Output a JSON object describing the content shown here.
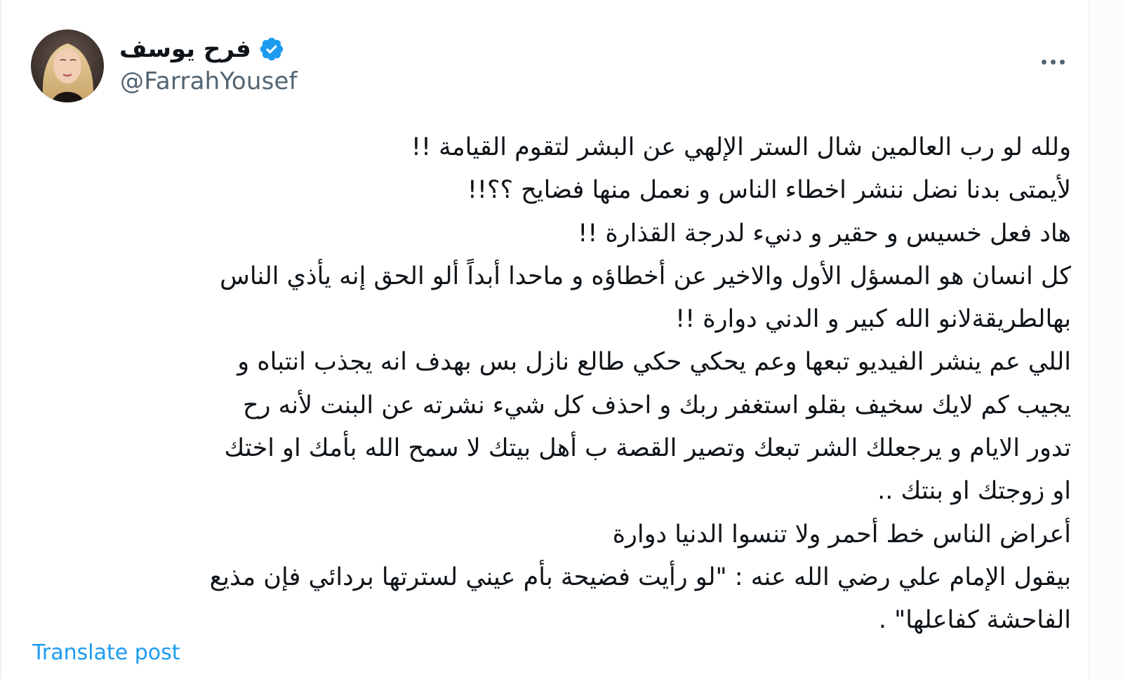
{
  "author": {
    "display_name": "فرح يوسف",
    "handle": "@FarrahYousef",
    "verified": true,
    "verified_color": "#1d9bf0"
  },
  "icons": {
    "verified": "verified-badge-icon",
    "more": "more-options-icon",
    "avatar": "profile-photo"
  },
  "tweet": {
    "lines": [
      "ولله لو رب العالمين شال الستر الإلهي عن البشر لتقوم القيامة !!",
      "لأيمتى بدنا نضل ننشر اخطاء الناس و نعمل منها فضايح ؟؟!!",
      "هاد فعل خسيس و حقير و دنيء لدرجة القذارة !!",
      "كل انسان هو المسؤل الأول والاخير عن أخطاؤه و ماحدا أبداً ألو الحق إنه يأذي الناس",
      "بهالطريقةلانو الله كبير و الدني دوارة !!",
      "اللي عم ينشر الفيديو تبعها وعم يحكي حكي طالع نازل بس بهدف انه يجذب انتباه و",
      "يجيب كم لايك سخيف بقلو استغفر ربك و احذف كل شيء نشرته عن البنت لأنه رح",
      "تدور الايام و يرجعلك الشر تبعك وتصير القصة ب أهل بيتك لا سمح الله بأمك او اختك",
      "او زوجتك او بنتك ..",
      "أعراض الناس خط أحمر ولا تنسوا الدنيا دوارة",
      "بيقول الإمام علي رضي الله عنه : \"لو رأيت فضيحة بأم عيني لسترتها بردائي فإن مذيع",
      "الفاحشة كفاعلها\" ."
    ]
  },
  "actions": {
    "translate_label": "Translate post"
  },
  "colors": {
    "text": "#0f1419",
    "secondary": "#536471",
    "link": "#1d9bf0"
  }
}
